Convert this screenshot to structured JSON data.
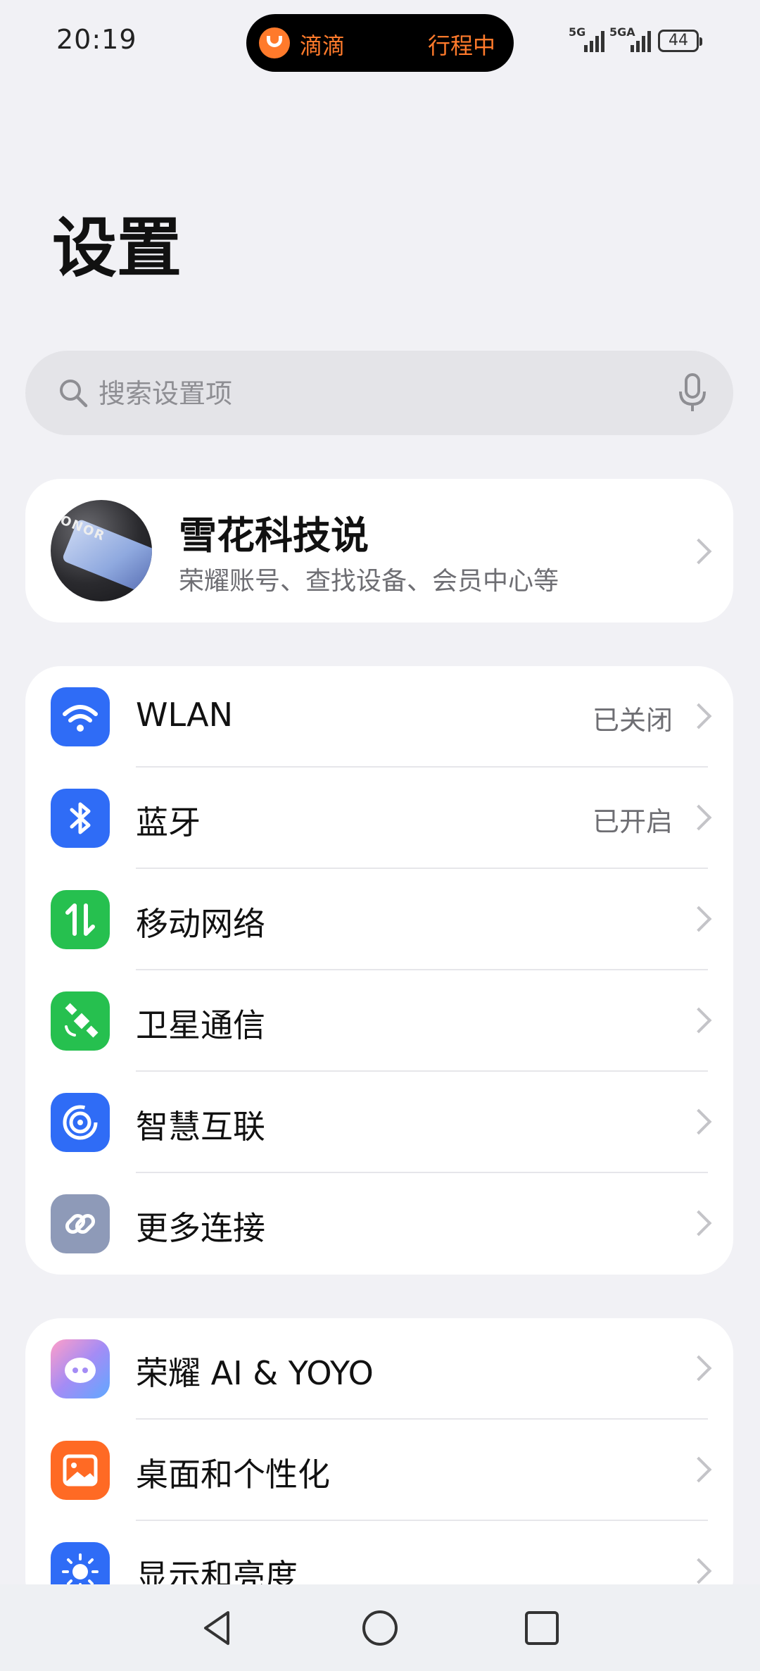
{
  "status_bar": {
    "time": "20:19",
    "pill_app": "滴滴",
    "pill_status": "行程中",
    "signal1_label": "5G",
    "signal2_label": "5GA",
    "battery": "44",
    "accent_color": "#ff7a2b"
  },
  "title": "设置",
  "search": {
    "placeholder": "搜索设置项",
    "value": ""
  },
  "account": {
    "name": "雪花科技说",
    "subtitle": "荣耀账号、查找设备、会员中心等",
    "avatar_text": "ONOR"
  },
  "connectivity": [
    {
      "label": "WLAN",
      "value": "已关闭",
      "icon": "wifi-icon",
      "color": "#2f6cf6"
    },
    {
      "label": "蓝牙",
      "value": "已开启",
      "icon": "bluetooth-icon",
      "color": "#2f6cf6"
    },
    {
      "label": "移动网络",
      "value": "",
      "icon": "mobile-data-icon",
      "color": "#26c04f"
    },
    {
      "label": "卫星通信",
      "value": "",
      "icon": "satellite-icon",
      "color": "#26c04f"
    },
    {
      "label": "智慧互联",
      "value": "",
      "icon": "smart-connect-icon",
      "color": "#2f6cf6"
    },
    {
      "label": "更多连接",
      "value": "",
      "icon": "link-icon",
      "color": "#8e9ab8"
    }
  ],
  "general": [
    {
      "label": "荣耀 AI & YOYO",
      "icon": "yoyo-icon",
      "color": "#a48cf5"
    },
    {
      "label": "桌面和个性化",
      "icon": "wallpaper-icon",
      "color": "#ff6a24"
    },
    {
      "label": "显示和亮度",
      "icon": "brightness-icon",
      "color": "#2f6cf6"
    }
  ]
}
